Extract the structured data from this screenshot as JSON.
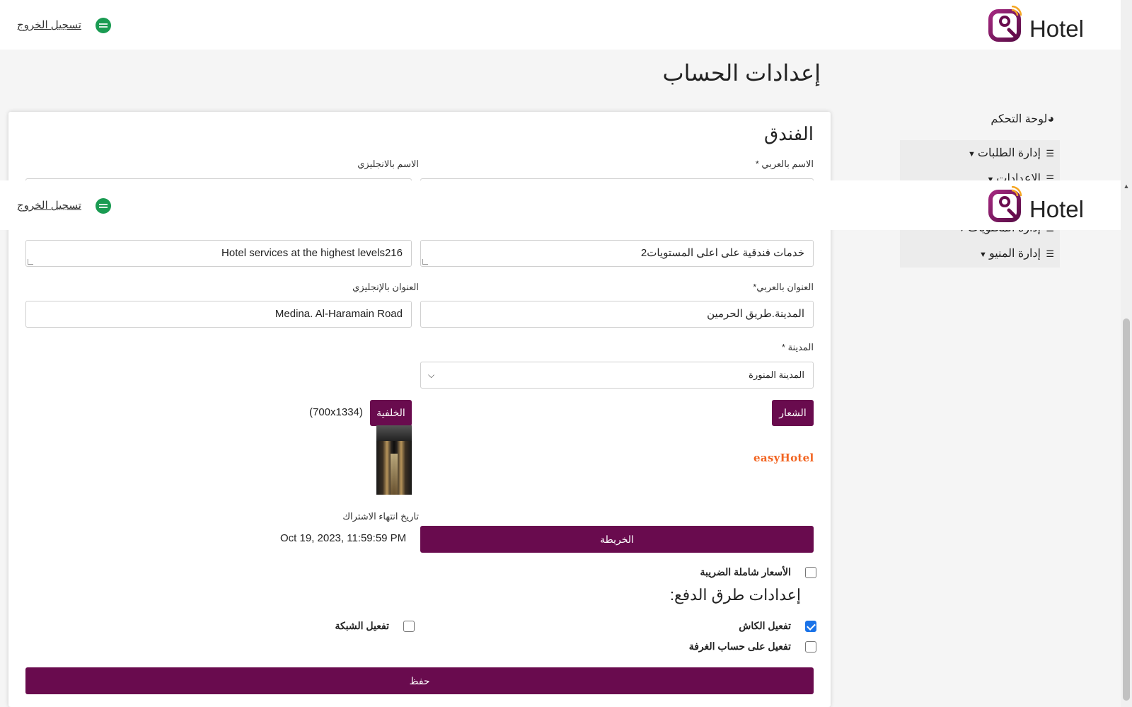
{
  "header": {
    "logo_text": "Hotel",
    "logout_label": "تسجيل الخروج"
  },
  "page": {
    "title": "إعدادات الحساب"
  },
  "sidebar": {
    "dashboard_label": "لوحة التحكم",
    "items": [
      {
        "label": "إدارة الطلبات"
      },
      {
        "label": "الاعدادات"
      },
      {
        "label": "إدارة المحتويات"
      },
      {
        "label": "إدارة المنيو"
      }
    ]
  },
  "hotel": {
    "section_title": "الفندق",
    "name_ar_label": "الاسم بالعربي *",
    "name_en_label": "الاسم بالانجليزي",
    "desc_ar_value": "خدمات فندقية على اعلى المستويات2",
    "desc_en_value": "Hotel services at the highest levels216",
    "address_ar_label": "العنوان بالعربي*",
    "address_ar_value": "المدينة.طريق الحرمين",
    "address_en_label": "العنوان بالإنجليزي",
    "address_en_value": "Medina. Al-Haramain Road",
    "city_label": "المدينة *",
    "city_value": "المدينة المنورة",
    "logo_button": "الشعار",
    "logo_brand_text": "easyHotel",
    "background_button": "الخلفية",
    "background_size": "(700x1334)",
    "map_button": "الخريطة",
    "subscription_label": "تاريخ انتهاء الاشتراك",
    "subscription_value": "Oct 19, 2023, 11:59:59 PM",
    "tax_inclusive_label": "الأسعار شاملة الضريبة"
  },
  "payment": {
    "title": "إعدادات طرق الدفع:",
    "cash_label": "تفعيل الكاش",
    "cash_checked": true,
    "room_label": "تفعيل على حساب الغرفة",
    "room_checked": false,
    "network_label": "تفعيل الشبكة",
    "network_checked": false
  },
  "actions": {
    "save_label": "حفظ"
  },
  "colors": {
    "primary": "#690b4e",
    "accent": "#8b1a6e",
    "brand_orange": "#f26522"
  },
  "icons": {
    "dashboard": "pie-chart-icon",
    "menu_item": "layers-icon",
    "caret": "caret-down-icon",
    "select": "chevron-down-icon",
    "flag": "saudi-flag-icon"
  }
}
